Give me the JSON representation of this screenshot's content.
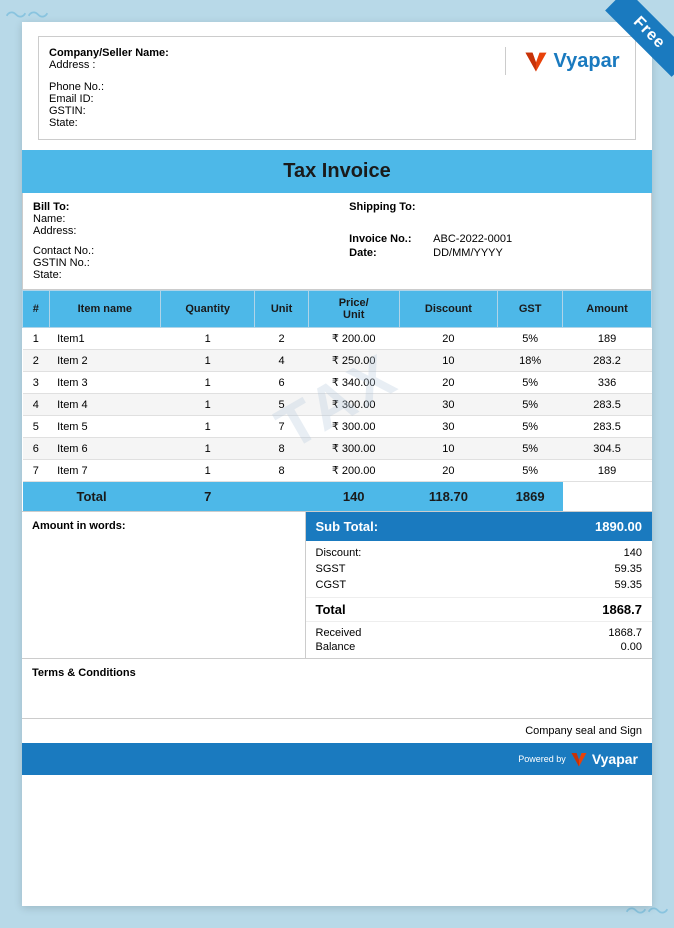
{
  "banner": {
    "label": "Free"
  },
  "header": {
    "company_label": "Company/Seller Name:",
    "address_label": "Address :",
    "phone_label": "Phone No.:",
    "email_label": "Email ID:",
    "gstin_label": "GSTIN:",
    "state_label": "State:",
    "logo_text": "Vyapar"
  },
  "title": "Tax Invoice",
  "billing": {
    "bill_to_label": "Bill To:",
    "name_label": "Name:",
    "address_label": "Address:",
    "contact_label": "Contact No.:",
    "gstin_label": "GSTIN No.:",
    "state_label": "State:",
    "ship_to_label": "Shipping To:",
    "invoice_no_label": "Invoice No.:",
    "invoice_no_value": "ABC-2022-0001",
    "date_label": "Date:",
    "date_value": "DD/MM/YYYY"
  },
  "table": {
    "headers": [
      "#",
      "Item name",
      "Quantity",
      "Unit",
      "Price/ Unit",
      "Discount",
      "GST",
      "Amount"
    ],
    "rows": [
      {
        "num": "1",
        "name": "Item1",
        "qty": "1",
        "unit": "2",
        "price": "₹ 200.00",
        "discount": "20",
        "gst": "5%",
        "amount": "189"
      },
      {
        "num": "2",
        "name": "Item 2",
        "qty": "1",
        "unit": "4",
        "price": "₹ 250.00",
        "discount": "10",
        "gst": "18%",
        "amount": "283.2"
      },
      {
        "num": "3",
        "name": "Item 3",
        "qty": "1",
        "unit": "6",
        "price": "₹ 340.00",
        "discount": "20",
        "gst": "5%",
        "amount": "336"
      },
      {
        "num": "4",
        "name": "Item 4",
        "qty": "1",
        "unit": "5",
        "price": "₹ 300.00",
        "discount": "30",
        "gst": "5%",
        "amount": "283.5"
      },
      {
        "num": "5",
        "name": "Item 5",
        "qty": "1",
        "unit": "7",
        "price": "₹ 300.00",
        "discount": "30",
        "gst": "5%",
        "amount": "283.5"
      },
      {
        "num": "6",
        "name": "Item 6",
        "qty": "1",
        "unit": "8",
        "price": "₹ 300.00",
        "discount": "10",
        "gst": "5%",
        "amount": "304.5"
      },
      {
        "num": "7",
        "name": "Item 7",
        "qty": "1",
        "unit": "8",
        "price": "₹ 200.00",
        "discount": "20",
        "gst": "5%",
        "amount": "189"
      }
    ],
    "total_label": "Total",
    "total_qty": "7",
    "total_discount": "140",
    "total_gst": "118.70",
    "total_amount": "1869"
  },
  "summary": {
    "amount_in_words_label": "Amount in words:",
    "sub_total_label": "Sub Total:",
    "sub_total_value": "1890.00",
    "discount_label": "Discount:",
    "discount_value": "140",
    "sgst_label": "SGST",
    "sgst_value": "59.35",
    "cgst_label": "CGST",
    "cgst_value": "59.35",
    "total_label": "Total",
    "total_value": "1868.7",
    "received_label": "Received",
    "received_value": "1868.7",
    "balance_label": "Balance",
    "balance_value": "0.00"
  },
  "terms": {
    "label": "Terms & Conditions"
  },
  "seal": {
    "label": "Company seal and Sign"
  },
  "footer": {
    "powered_by": "Powered by",
    "vyapar": "Vyapar"
  },
  "watermark": "TAX"
}
